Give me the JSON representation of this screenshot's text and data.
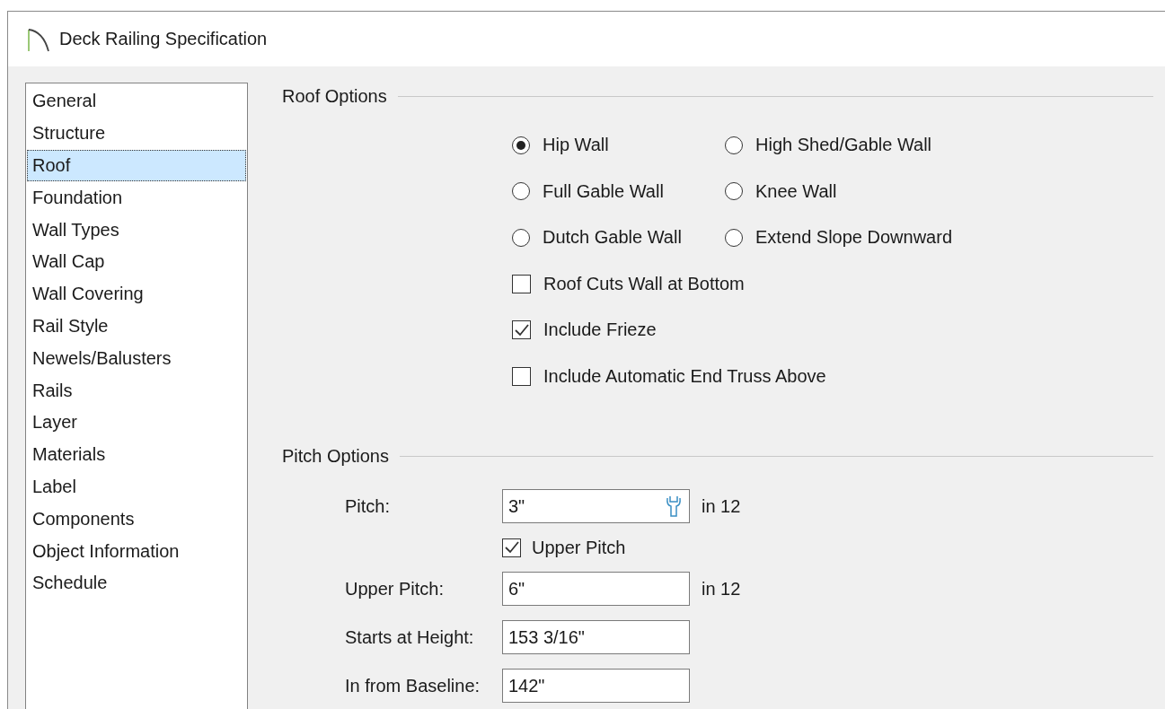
{
  "window": {
    "title": "Deck Railing Specification"
  },
  "sidebar": {
    "items": [
      {
        "label": "General",
        "selected": false
      },
      {
        "label": "Structure",
        "selected": false
      },
      {
        "label": "Roof",
        "selected": true
      },
      {
        "label": "Foundation",
        "selected": false
      },
      {
        "label": "Wall Types",
        "selected": false
      },
      {
        "label": "Wall Cap",
        "selected": false
      },
      {
        "label": "Wall Covering",
        "selected": false
      },
      {
        "label": "Rail Style",
        "selected": false
      },
      {
        "label": "Newels/Balusters",
        "selected": false
      },
      {
        "label": "Rails",
        "selected": false
      },
      {
        "label": "Layer",
        "selected": false
      },
      {
        "label": "Materials",
        "selected": false
      },
      {
        "label": "Label",
        "selected": false
      },
      {
        "label": "Components",
        "selected": false
      },
      {
        "label": "Object Information",
        "selected": false
      },
      {
        "label": "Schedule",
        "selected": false
      }
    ]
  },
  "roof_options": {
    "title": "Roof Options",
    "radios": [
      {
        "label": "Hip Wall",
        "selected": true
      },
      {
        "label": "High Shed/Gable Wall",
        "selected": false
      },
      {
        "label": "Full Gable Wall",
        "selected": false
      },
      {
        "label": "Knee Wall",
        "selected": false
      },
      {
        "label": "Dutch Gable Wall",
        "selected": false
      },
      {
        "label": "Extend Slope Downward",
        "selected": false
      }
    ],
    "checkboxes": [
      {
        "label": "Roof Cuts Wall at Bottom",
        "checked": false
      },
      {
        "label": "Include Frieze",
        "checked": true
      },
      {
        "label": "Include Automatic End Truss Above",
        "checked": false
      }
    ]
  },
  "pitch_options": {
    "title": "Pitch Options",
    "rows": [
      {
        "kind": "tool-field",
        "label": "Pitch:",
        "value": "3\"",
        "unit": "in 12"
      },
      {
        "kind": "checkbox",
        "label": "Upper Pitch",
        "checked": true
      },
      {
        "kind": "field",
        "label": "Upper Pitch:",
        "value": "6\"",
        "unit": "in 12"
      },
      {
        "kind": "field",
        "label": "Starts at Height:",
        "value": "153 3/16\""
      },
      {
        "kind": "field",
        "label": "In from Baseline:",
        "value": "142\""
      }
    ]
  }
}
